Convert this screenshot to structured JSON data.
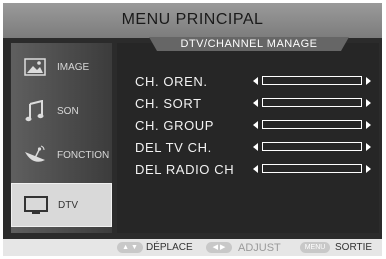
{
  "menu": {
    "title": "MENU PRINCIPAL",
    "subtitle": "DTV/CHANNEL MANAGE"
  },
  "sidebar": {
    "items": [
      {
        "label": "IMAGE",
        "icon": "image-icon",
        "active": false
      },
      {
        "label": "SON",
        "icon": "music-note-icon",
        "active": false
      },
      {
        "label": "FONCTION",
        "icon": "satellite-dish-icon",
        "active": false
      },
      {
        "label": "DTV",
        "icon": "tv-monitor-icon",
        "active": true
      }
    ]
  },
  "options": [
    {
      "label": "CH.  OREN."
    },
    {
      "label": "CH.  SORT"
    },
    {
      "label": "CH.  GROUP"
    },
    {
      "label": "DEL TV CH."
    },
    {
      "label": "DEL RADIO CH"
    }
  ],
  "footer": {
    "move_label": "DÉPLACE",
    "adjust_label": "ADJUST",
    "menu_key": "MENU",
    "exit_label": "SORTIE"
  },
  "colors": {
    "title_bar": "#8a8a8a",
    "background": "#262626",
    "active_item": "#d9d9d9",
    "footer": "#e6e6e6"
  }
}
